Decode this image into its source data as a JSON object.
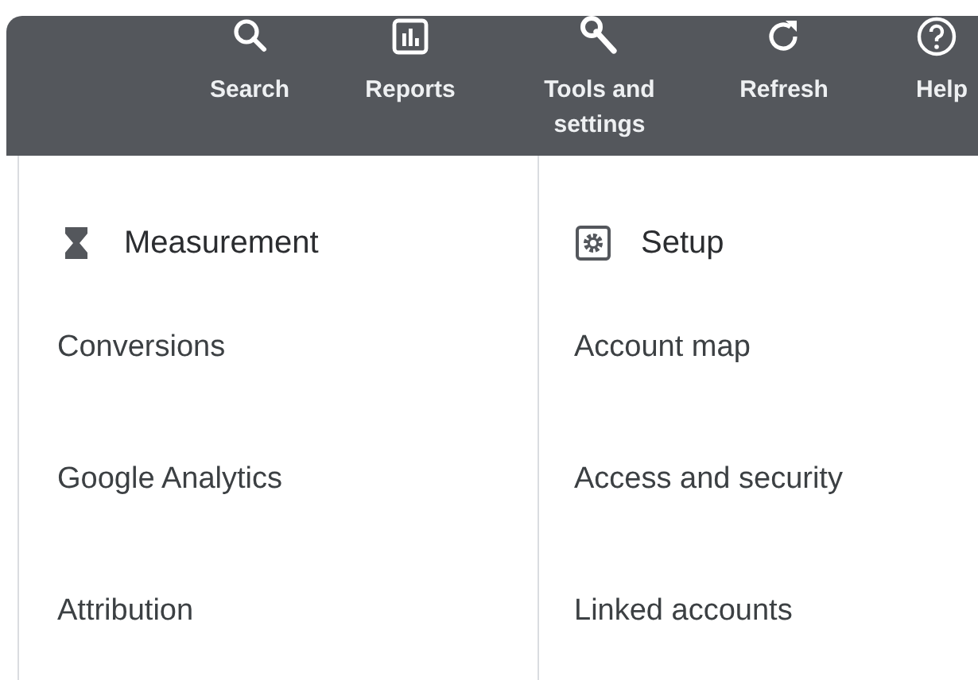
{
  "toolbar": {
    "items": [
      {
        "kind": "search",
        "label": "Search"
      },
      {
        "kind": "reports",
        "label": "Reports"
      },
      {
        "kind": "tools",
        "label": "Tools and settings"
      },
      {
        "kind": "refresh",
        "label": "Refresh"
      },
      {
        "kind": "help",
        "label": "Help"
      }
    ]
  },
  "columns": [
    {
      "kind": "measurement",
      "title": "Measurement",
      "items": [
        "Conversions",
        "Google Analytics",
        "Attribution"
      ]
    },
    {
      "kind": "setup",
      "title": "Setup",
      "items": [
        "Account map",
        "Access and security",
        "Linked accounts"
      ]
    }
  ]
}
